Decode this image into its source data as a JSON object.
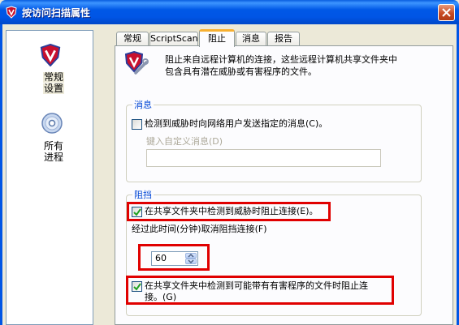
{
  "window": {
    "title": "按访问扫描属性",
    "close_icon": "close-icon"
  },
  "sidebar": {
    "items": [
      {
        "icon": "shield-v-icon",
        "label": "常规\n设置",
        "line1": "常规",
        "line2": "设置",
        "selected": true
      },
      {
        "icon": "disc-icon",
        "label": "所有\n进程",
        "line1": "所有",
        "line2": "进程",
        "selected": false
      }
    ]
  },
  "tabs": [
    {
      "label": "常规",
      "active": false
    },
    {
      "label": "ScriptScan",
      "active": false
    },
    {
      "label": "阻止",
      "active": true
    },
    {
      "label": "消息",
      "active": false
    },
    {
      "label": "报告",
      "active": false
    }
  ],
  "description": {
    "line1": "阻止来自远程计算机的连接，这些远程计算机共享文件夹中",
    "line2": "包含具有潜在威胁或有害程序的文件。"
  },
  "message_group": {
    "title": "消息",
    "send_message_checkbox": {
      "label": "检测到威胁时向网络用户发送指定的消息(C)。",
      "checked": false
    },
    "custom_message_label": "键入自定义消息(D)",
    "custom_message_value": ""
  },
  "block_group": {
    "title": "阻挡",
    "block_threat_checkbox": {
      "label": "在共享文件夹中检测到威胁时阻止连接(E)。",
      "checked": true
    },
    "unblock_time_label": "经过此时间(分钟)取消阻挡连接(F)",
    "unblock_time_value": "60",
    "block_pup_checkbox": {
      "line1": "在共享文件夹中检测到可能带有有害程序的文件时阻止连",
      "line2": "接。(G)",
      "checked": true
    }
  },
  "colors": {
    "titlebar": "#0055e5",
    "highlight": "#e00000",
    "group_title": "#0046d5"
  }
}
